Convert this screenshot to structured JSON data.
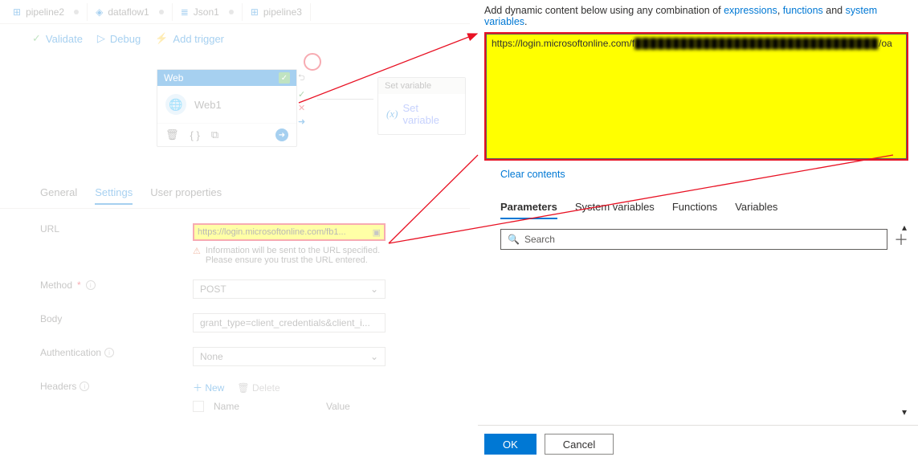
{
  "tabs": [
    {
      "icon": "⊞",
      "label": "pipeline2"
    },
    {
      "icon": "◇",
      "label": "dataflow1"
    },
    {
      "icon": "≡",
      "label": "Json1"
    },
    {
      "icon": "⊞",
      "label": "pipeline3"
    }
  ],
  "actions": {
    "validate": "Validate",
    "debug": "Debug",
    "addtrigger": "Add trigger"
  },
  "web_card": {
    "header": "Web",
    "name": "Web1"
  },
  "setvar_card": {
    "header": "Set variable",
    "name": "Set variable"
  },
  "prop_tabs": {
    "general": "General",
    "settings": "Settings",
    "userprops": "User properties"
  },
  "props": {
    "url_label": "URL",
    "url_value": "https://login.microsoftonline.com/fb1...",
    "url_warn": "Information will be sent to the URL specified. Please ensure you trust the URL entered.",
    "method_label": "Method",
    "method_value": "POST",
    "body_label": "Body",
    "body_value": "grant_type=client_credentials&client_i...",
    "auth_label": "Authentication",
    "auth_value": "None",
    "headers_label": "Headers",
    "new": "New",
    "delete": "Delete",
    "col_name": "Name",
    "col_value": "Value"
  },
  "right": {
    "intro_pre": "Add dynamic content below using any combination of ",
    "link1": "expressions",
    "sep1": ", ",
    "link2": "functions",
    "sep2": " and ",
    "link3": "system variables",
    "dot": ".",
    "editor_prefix": "https://login.microsoftonline.com/f",
    "editor_redacted": "████████████████████████████████",
    "editor_suffix": "/oa",
    "clear": "Clear contents",
    "tabs": {
      "params": "Parameters",
      "sys": "System variables",
      "funcs": "Functions",
      "vars": "Variables"
    },
    "search_ph": "Search",
    "ok": "OK",
    "cancel": "Cancel"
  }
}
